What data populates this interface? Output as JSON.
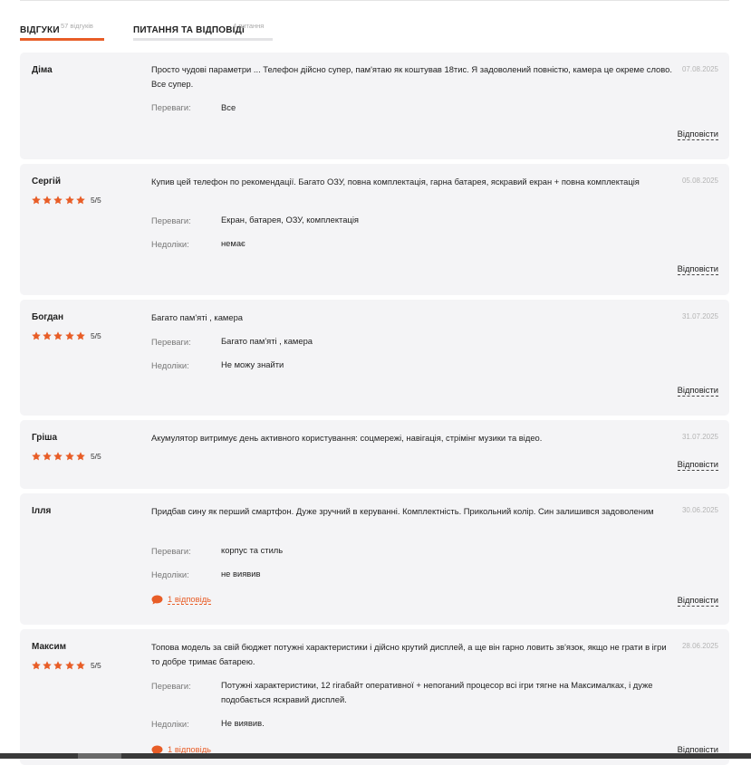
{
  "colors": {
    "accent": "#e85d27",
    "card_bg": "#f4f4f6",
    "muted": "#777777"
  },
  "tabs": [
    {
      "label": "ВІДГУКИ",
      "count": "57 відгуків",
      "active": true
    },
    {
      "label": "ПИТАННЯ ТА ВІДПОВІДІ",
      "count": "4 питання",
      "active": false
    }
  ],
  "reviews": [
    {
      "author": "Діма",
      "date": "07.08.2025",
      "text": "Просто чудові параметри ... Телефон дійсно супер, пам'ятаю як коштував 18тис. Я задоволений повністю, камера це окреме слово. Все супер.",
      "pros_label": "Переваги:",
      "pros": "Все",
      "reply_label": "Відповісти"
    },
    {
      "author": "Сергій",
      "rating": 5,
      "score": "5/5",
      "date": "05.08.2025",
      "text": "Купив цей телефон по рекомендації. Багато ОЗУ, повна комплектація, гарна батарея, яскравий екран + повна комплектація",
      "pros_label": "Переваги:",
      "pros": "Екран, батарея, ОЗУ, комплектація",
      "cons_label": "Недоліки:",
      "cons": "немає",
      "reply_label": "Відповісти"
    },
    {
      "author": "Богдан",
      "rating": 5,
      "score": "5/5",
      "date": "31.07.2025",
      "text": "Багато пам'яті , камера",
      "pros_label": "Переваги:",
      "pros": "Багато пам'яті , камера",
      "cons_label": "Недоліки:",
      "cons": "Не можу знайти",
      "reply_label": "Відповісти"
    },
    {
      "author": "Гріша",
      "rating": 5,
      "score": "5/5",
      "date": "31.07.2025",
      "text": "Акумулятор витримує день активного користування: соцмережі, навігація, стрімінг музики та відео.",
      "reply_label": "Відповісти"
    },
    {
      "author": "Ілля",
      "date": "30.06.2025",
      "text": "Придбав сину як перший смартфон. Дуже зручний в керуванні. Комплектність. Прикольний колір. Син залишився задоволеним",
      "pros_label": "Переваги:",
      "pros": "корпус та стиль",
      "cons_label": "Недоліки:",
      "cons": "не виявив",
      "answers": "1 відповідь",
      "reply_label": "Відповісти"
    },
    {
      "author": "Максим",
      "rating": 5,
      "score": "5/5",
      "date": "28.06.2025",
      "text": "Топова модель за свій бюджет потужні характеристики і дійсно крутий дисплей, а ще він гарно ловить зв'язок, якщо не грати в ігри то добре тримає батарею.",
      "pros_label": "Переваги:",
      "pros": "Потужні характеристики, 12 гігабайт оперативної + непоганий процесор всі ігри тягне на Максималках, і дуже подобається яскравий дисплей.",
      "cons_label": "Недоліки:",
      "cons": "Не виявив.",
      "answers": "1 відповідь",
      "reply_label": "Відповісти"
    }
  ]
}
